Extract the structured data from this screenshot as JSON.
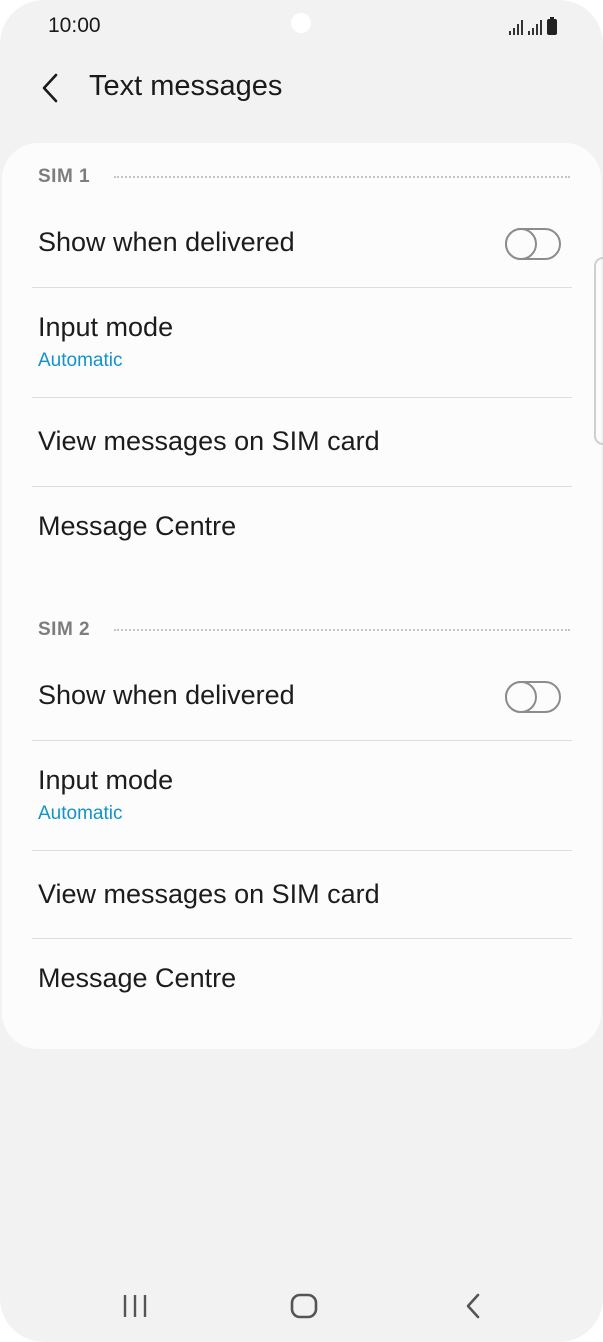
{
  "status_bar": {
    "time": "10:00",
    "icons": [
      "signal-sim1-icon",
      "signal-sim2-icon",
      "battery-icon"
    ]
  },
  "app_bar": {
    "back_icon": "chevron-left-icon",
    "title": "Text messages"
  },
  "sections": [
    {
      "label": "SIM 1",
      "items": [
        {
          "title": "Show when delivered",
          "type": "toggle",
          "toggle_on": false
        },
        {
          "title": "Input mode",
          "subtitle": "Automatic",
          "type": "value"
        },
        {
          "title": "View messages on SIM card",
          "type": "link"
        },
        {
          "title": "Message Centre",
          "type": "link"
        }
      ]
    },
    {
      "label": "SIM 2",
      "items": [
        {
          "title": "Show when delivered",
          "type": "toggle",
          "toggle_on": false
        },
        {
          "title": "Input mode",
          "subtitle": "Automatic",
          "type": "value"
        },
        {
          "title": "View messages on SIM card",
          "type": "link"
        },
        {
          "title": "Message Centre",
          "type": "link"
        }
      ]
    }
  ],
  "nav_bar": {
    "recents_icon": "recents-icon",
    "home_icon": "home-icon",
    "back_icon": "back-icon"
  },
  "colors": {
    "background": "#f2f2f2",
    "card": "#fcfcfc",
    "accent": "#1294c9",
    "text": "#1c1c1c",
    "section_label": "#7d7d7d"
  }
}
